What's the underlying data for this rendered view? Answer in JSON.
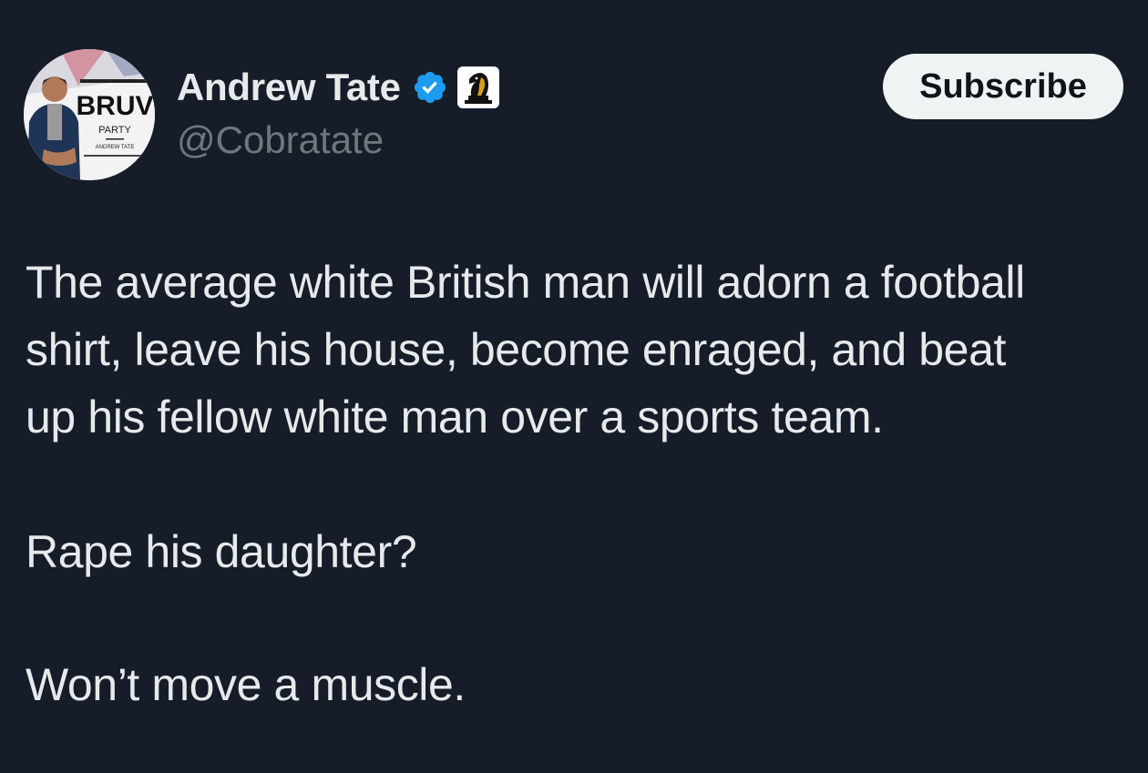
{
  "author": {
    "display_name": "Andrew Tate",
    "handle": "@Cobratate",
    "verified_icon": "verified-badge-icon",
    "affiliate_icon": "chess-knight-icon",
    "avatar_text": {
      "top": "BRUV",
      "middle": "PARTY",
      "bottom": "ANDREW TATE"
    }
  },
  "actions": {
    "subscribe_label": "Subscribe"
  },
  "tweet": {
    "paragraph1_lines": [
      "The average white British man will adorn a football",
      "shirt, leave his house, become enraged, and beat",
      "up his fellow white man over a sports team."
    ],
    "paragraph2": "Rape his daughter?",
    "paragraph3": "Won’t move a muscle."
  },
  "colors": {
    "background": "#161d29",
    "text_primary": "#e7e9ea",
    "text_secondary": "#71767b",
    "verified_blue": "#1d9bf0",
    "button_bg": "#eff3f4",
    "button_text": "#0f1419"
  }
}
